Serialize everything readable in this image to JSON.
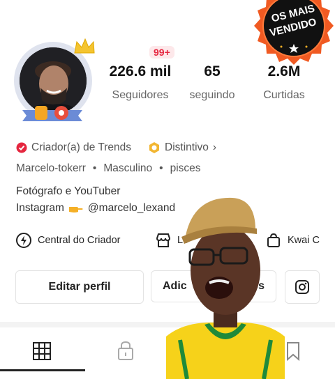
{
  "profile": {
    "stats": [
      {
        "value": "226.6 mil",
        "label": "Seguidores"
      },
      {
        "value": "65",
        "label": "seguindo"
      },
      {
        "value": "2.6M",
        "label": "Curtidas"
      }
    ],
    "notification_badge": "99+",
    "tags": {
      "creator": "Criador(a) de Trends",
      "distinctive": "Distintivo",
      "chevron": "›"
    },
    "info": {
      "username": "Marcelo-tokerr",
      "gender": "Masculino",
      "sign": "pisces",
      "dot": "•"
    },
    "bio_line1": "Fotógrafo e YouTuber",
    "bio_line2_prefix": "Instagram",
    "bio_line2_handle": "@marcelo_lexand"
  },
  "tools": {
    "creator_center": "Central do Criador",
    "store": "Lo",
    "kwai": "Kwai C"
  },
  "buttons": {
    "edit_profile": "Editar perfil",
    "add_friends": "Adic",
    "add_friends_tail": "os"
  },
  "seal": {
    "line1": "OS MAIS",
    "line2": "VENDIDO"
  },
  "colors": {
    "accent_red": "#e5263f",
    "seal_orange": "#f05a22",
    "seal_black": "#111111",
    "jersey_yellow": "#f6d21a",
    "jersey_green": "#1f8a3a"
  }
}
